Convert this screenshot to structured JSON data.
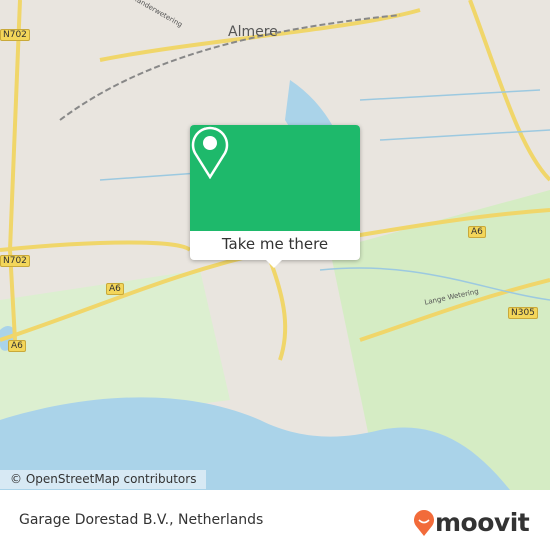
{
  "map": {
    "labels": {
      "city": "Almere",
      "lange_wetering": "Lange Wetering",
      "alexanderwetering": "Alexanderwetering"
    },
    "road_shields": [
      "N702",
      "A6",
      "A6",
      "A6",
      "N305",
      "N702"
    ],
    "attribution": "© OpenStreetMap contributors"
  },
  "popup": {
    "button_label": "Take me there",
    "color": "#1eb96b"
  },
  "footer": {
    "place": "Garage Dorestad B.V., Netherlands",
    "brand": "moovit",
    "brand_color": "#f26b3a"
  }
}
